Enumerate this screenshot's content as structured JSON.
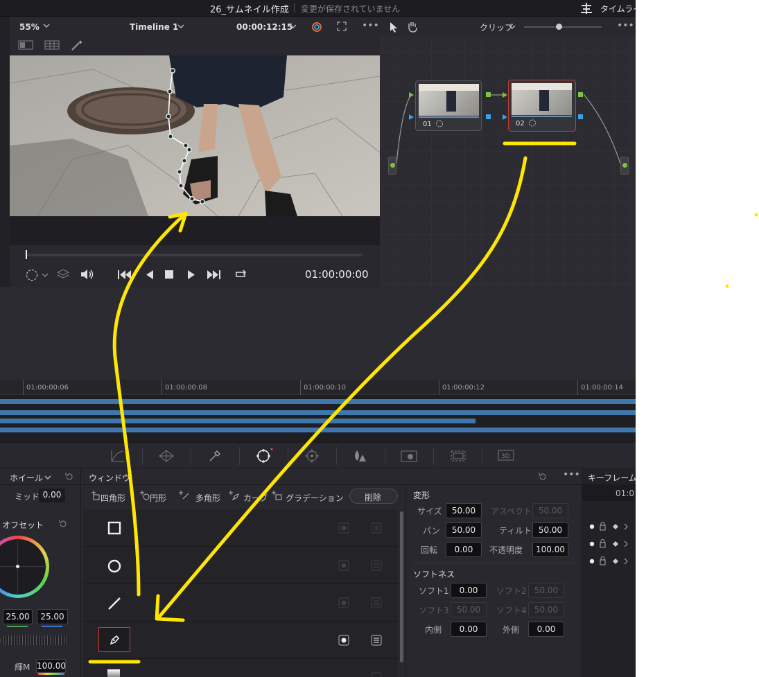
{
  "titlebar": {
    "project": "26_サムネイル作成",
    "status": "変更が保存されていません",
    "right": "タイムライン"
  },
  "viewer": {
    "zoom": "55%",
    "timeline": "Timeline 1",
    "timecode": "00:00:12:15",
    "playhead_tc": "01:00:00:00"
  },
  "node_editor": {
    "mode": "クリップ",
    "nodes": [
      {
        "label": "01"
      },
      {
        "label": "02"
      }
    ]
  },
  "ruler": {
    "ticks": [
      "01:00:00:06",
      "01:00:00:08",
      "01:00:00:10",
      "01:00:00:12",
      "01:00:00:14"
    ]
  },
  "color_panel": {
    "mode": "ホイール",
    "mid_label": "ミッド",
    "mid_value": "0.00",
    "offset_label": "オフセット",
    "val1": "25.00",
    "val2": "25.00",
    "lum_label": "輝M",
    "lum_value": "100.00"
  },
  "window_panel": {
    "title": "ウィンドウ",
    "tools": [
      "四角形",
      "円形",
      "多角形",
      "カーブ",
      "グラデーション"
    ],
    "delete_label": "削除",
    "rows": [
      {
        "shape": "square"
      },
      {
        "shape": "circle"
      },
      {
        "shape": "line"
      },
      {
        "shape": "pen"
      }
    ]
  },
  "transform": {
    "title": "変形",
    "size_label": "サイズ",
    "size": "50.00",
    "aspect_label": "アスペクト",
    "aspect": "50.00",
    "pan_label": "パン",
    "pan": "50.00",
    "tilt_label": "ティルト",
    "tilt": "50.00",
    "rotate_label": "回転",
    "rotate": "0.00",
    "opacity_label": "不透明度",
    "opacity": "100.00"
  },
  "softness": {
    "title": "ソフトネス",
    "s1_label": "ソフト1",
    "s1": "0.00",
    "s2_label": "ソフト2",
    "s2": "50.00",
    "s3_label": "ソフト3",
    "s3": "50.00",
    "s4_label": "ソフト4",
    "s4": "50.00",
    "inner_label": "内側",
    "inner": "0.00",
    "outer_label": "外側",
    "outer": "0.00"
  },
  "keyframes": {
    "title": "キーフレーム",
    "tc": "01:0"
  },
  "colors": {
    "accent_highlight": "#ffe600",
    "node_selected_border": "#d0392b",
    "clip_track": "#3f77ad"
  }
}
